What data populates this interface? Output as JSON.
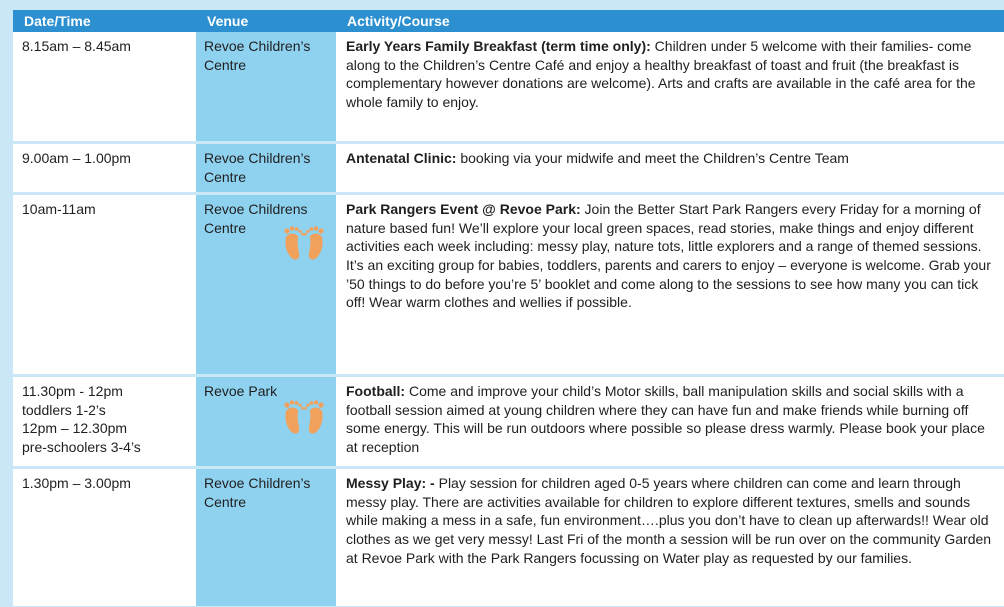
{
  "header": {
    "col_datetime": "Date/Time",
    "col_venue": "Venue",
    "col_activity": "Activity/Course"
  },
  "rows": [
    {
      "time": "8.15am – 8.45am",
      "venue": "Revoe Children’s Centre",
      "title": "Early Years Family Breakfast (term time only):",
      "description": " Children under 5 welcome with their families- come along to the Children’s Centre Café and enjoy a healthy breakfast of toast and fruit (the breakfast is complementary however donations are welcome). Arts and crafts are available in the café area for the whole family to enjoy."
    },
    {
      "time": "9.00am – 1.00pm",
      "venue": "Revoe Children’s Centre",
      "title": "Antenatal Clinic:",
      "description": " booking via your midwife and meet the Children’s Centre Team"
    },
    {
      "time": "10am-11am",
      "venue": "Revoe Childrens Centre",
      "icon": "footprints-icon",
      "title": "Park Rangers Event @ Revoe Park:",
      "description": " Join the Better Start Park Rangers every Friday for a morning of nature based fun! We’ll explore your local green spaces, read stories, make things and enjoy different activities each week including: messy play, nature tots, little explorers and a range of themed sessions. It’s an exciting group for babies, toddlers, parents and carers to enjoy – everyone is welcome. Grab your ’50 things to do before you’re 5’ booklet and come along to the sessions to see how many you can tick off! Wear warm clothes and wellies if possible."
    },
    {
      "time_lines": [
        "11.30pm - 12pm",
        "toddlers 1-2’s",
        "12pm – 12.30pm",
        "pre-schoolers 3-4’s"
      ],
      "venue": "Revoe Park",
      "icon": "footprints-icon",
      "title": "Football:",
      "description": " Come and improve your child’s Motor skills, ball manipulation skills and social skills with a football session aimed at young children where they can have fun and make friends while burning off some energy. This will be run outdoors where possible so please dress warmly. Please book your place at reception"
    },
    {
      "time": "1.30pm – 3.00pm",
      "venue": "Revoe Children’s Centre",
      "title": "Messy Play: -",
      "description": " Play session for children aged 0-5 years where children can come and learn through messy play. There are activities available for children to explore different textures, smells and sounds while making a mess in a safe, fun environment….plus you don’t have to clean up afterwards!! Wear old clothes as we get very messy! Last Fri of the month a session will be run over on the community Garden at Revoe Park with the Park Rangers focussing on Water play as requested by our families."
    }
  ],
  "colors": {
    "page_background": "#c9e7f7",
    "header_background": "#2b8fd0",
    "venue_background": "#8fd2f0",
    "footprint_color": "#f2a15c"
  }
}
